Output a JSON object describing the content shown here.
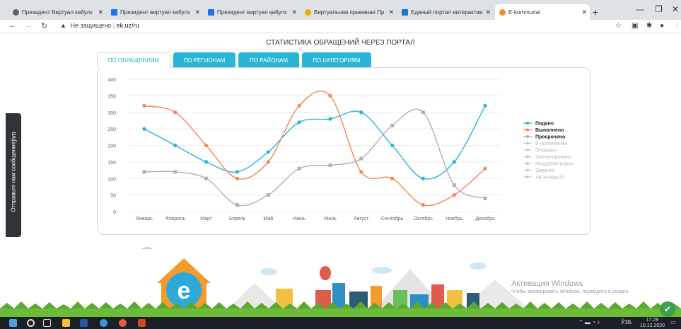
{
  "browser": {
    "tabs": [
      {
        "label": "Президент Виртуал кабулх",
        "color": "#5f6368"
      },
      {
        "label": "Президент виртуал кабулх",
        "color": "#1a73e8"
      },
      {
        "label": "Президент виртуал қабулх",
        "color": "#1a73e8"
      },
      {
        "label": "Виртуальная приемная Пр",
        "color": "#f2a900"
      },
      {
        "label": "Единый портал интерактив",
        "color": "#1976d2"
      },
      {
        "label": "E-kommunal",
        "color": "#f28c28"
      }
    ],
    "address": {
      "security": "Не защищено",
      "url": "ek.uz/ru"
    }
  },
  "page": {
    "title": "СТАТИСТИКА ОБРАЩЕНИЙ ЧЕРЕЗ ПОРТАЛ",
    "tabs": [
      "ПО ОБРАЩЕНИЯМ",
      "ПО РЕГИОНАМ",
      "ПО РАЙОНАМ",
      "ПО КАТЕГОРИЯМ"
    ],
    "active_tab": 0
  },
  "side_widget": {
    "label": "Отправьте нам сообщение",
    "logo": "jivo"
  },
  "watermark": {
    "title": "Активация Windows",
    "subtitle": "Чтобы активировать Windows, перейдите в раздел"
  },
  "taskbar": {
    "lang": "ЎЗБ",
    "time": "17:29",
    "date": "10.12.2020"
  },
  "chart_data": {
    "type": "line",
    "categories": [
      "Январь",
      "Февраль",
      "Март",
      "Апрель",
      "Май",
      "Июнь",
      "Июль",
      "Август",
      "Сентябрь",
      "Октябрь",
      "Ноябрь",
      "Декабрь"
    ],
    "ylim": [
      0,
      400
    ],
    "yticks": [
      0,
      50,
      100,
      150,
      200,
      250,
      300,
      350,
      400
    ],
    "grid": true,
    "legend_position": "right",
    "series": [
      {
        "name": "Подано",
        "color": "#29b6d6",
        "marker": "circle",
        "values": [
          250,
          200,
          150,
          120,
          180,
          270,
          280,
          300,
          200,
          100,
          150,
          320
        ]
      },
      {
        "name": "Выполнено",
        "color": "#f5865a",
        "marker": "circle",
        "values": [
          320,
          300,
          200,
          100,
          150,
          320,
          350,
          120,
          100,
          20,
          50,
          130
        ]
      },
      {
        "name": "Просрочено",
        "color": "#b0b0b0",
        "marker": "square",
        "values": [
          120,
          120,
          100,
          20,
          50,
          130,
          140,
          160,
          260,
          300,
          80,
          40
        ]
      }
    ],
    "inactive_legend": [
      "В исполнении",
      "Отказано",
      "Запланировано",
      "Неудовлетворен",
      "Закрыто",
      "Автозакрыто"
    ]
  }
}
